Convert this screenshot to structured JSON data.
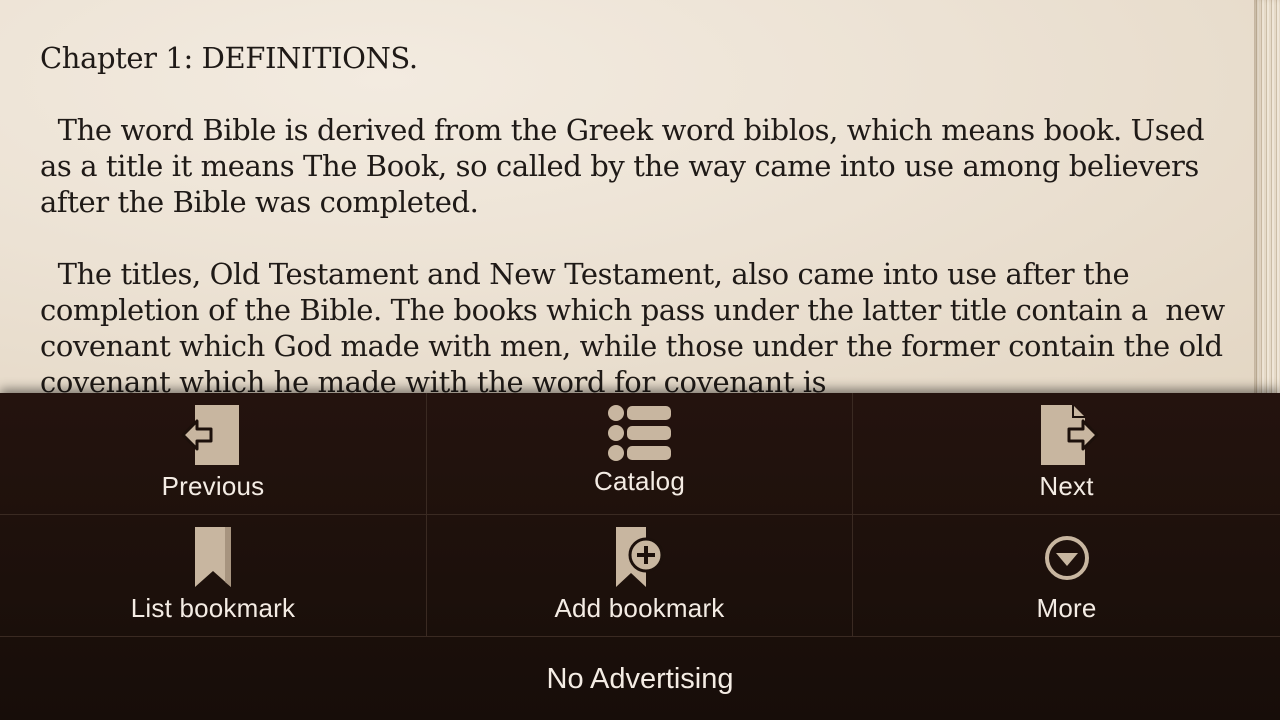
{
  "reader": {
    "heading": "Chapter 1: DEFINITIONS.",
    "paragraphs": [
      "  The word Bible is derived from the Greek word biblos, which means book. Used as a title it means The Book, so called by the way came into use among believers after the Bible was completed.",
      "  The titles, Old Testament and New Testament, also came into use after the completion of the Bible. The books which pass under the latter title contain a  new covenant which God made with men, while those under the former contain the old covenant which he made with the word for covenant is"
    ]
  },
  "menu": {
    "previous": {
      "label": "Previous",
      "icon": "document-arrow-left-icon"
    },
    "catalog": {
      "label": "Catalog",
      "icon": "list-icon"
    },
    "next": {
      "label": "Next",
      "icon": "document-arrow-right-icon"
    },
    "list_bookmark": {
      "label": "List bookmark",
      "icon": "bookmark-icon"
    },
    "add_bookmark": {
      "label": "Add bookmark",
      "icon": "bookmark-add-icon"
    },
    "more": {
      "label": "More",
      "icon": "chevron-down-circle-icon"
    },
    "no_advertising": {
      "label": "No Advertising"
    }
  },
  "colors": {
    "page": "#ece2d4",
    "text": "#1f1a17",
    "menu_background": "#1c100b",
    "menu_text": "#f4ece4",
    "icon": "#c8b6a0",
    "divider": "#3a2a22"
  }
}
